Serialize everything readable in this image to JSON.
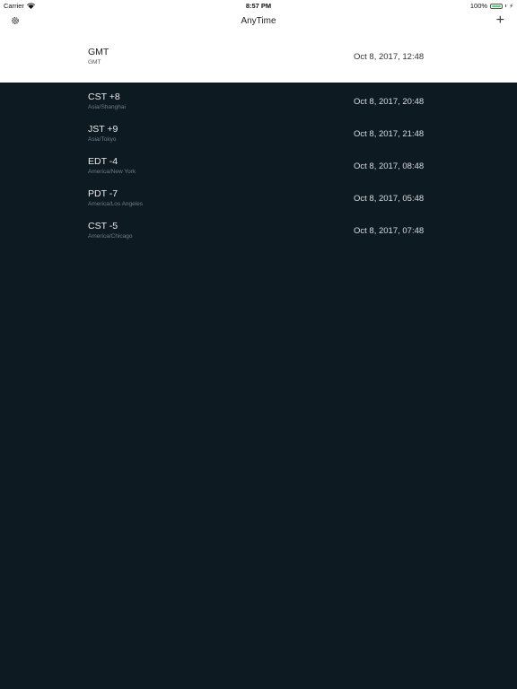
{
  "status": {
    "carrier": "Carrier",
    "time": "8:57 PM",
    "battery": "100%",
    "battery_level": 1.0
  },
  "nav": {
    "title": "AnyTime"
  },
  "home_zone": {
    "abbr": "GMT",
    "name": "GMT",
    "datetime": "Oct 8, 2017, 12:48"
  },
  "zones": [
    {
      "abbr": "CST +8",
      "name": "Asia/Shanghai",
      "datetime": "Oct 8, 2017, 20:48"
    },
    {
      "abbr": "JST +9",
      "name": "Asia/Tokyo",
      "datetime": "Oct 8, 2017, 21:48"
    },
    {
      "abbr": "EDT -4",
      "name": "America/New York",
      "datetime": "Oct 8, 2017, 08:48"
    },
    {
      "abbr": "PDT -7",
      "name": "America/Los Angeles",
      "datetime": "Oct 8, 2017, 05:48"
    },
    {
      "abbr": "CST -5",
      "name": "America/Chicago",
      "datetime": "Oct 8, 2017, 07:48"
    }
  ],
  "icons": {
    "wifi": "wifi-icon",
    "battery": "battery-icon",
    "charging": "charging-icon",
    "settings": "gear-icon",
    "add": "plus-icon"
  },
  "colors": {
    "background_dark": "#0e1a22",
    "header_background": "#ffffff",
    "battery_green": "#4cd964"
  }
}
